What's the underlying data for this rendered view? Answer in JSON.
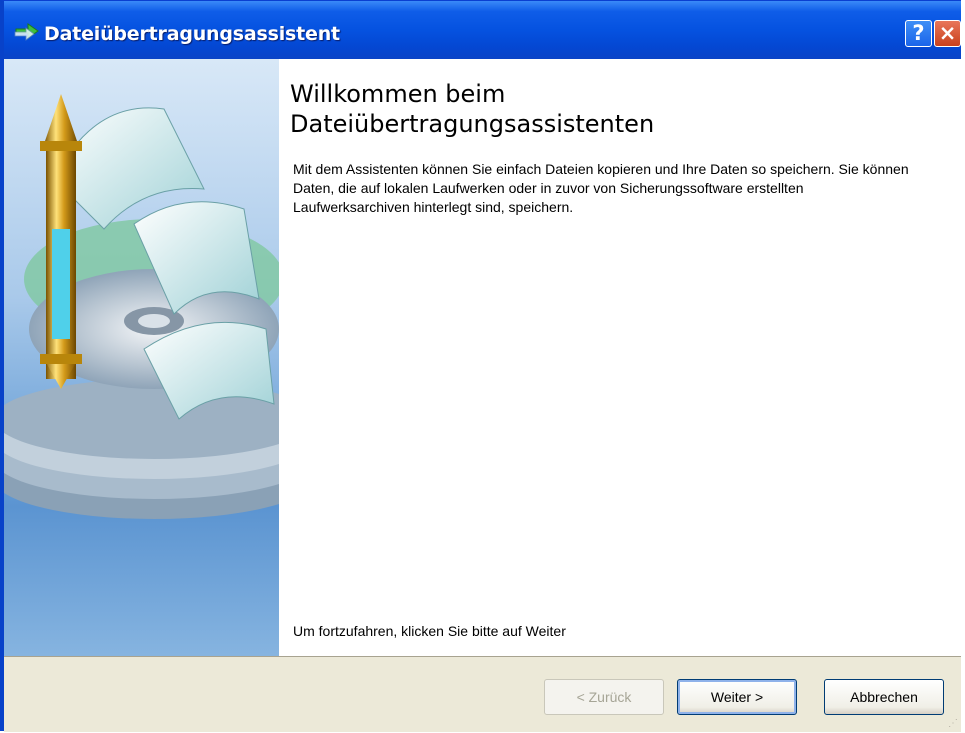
{
  "window": {
    "title": "Dateiübertragungsassistent",
    "help_label": "?",
    "close_label": "×"
  },
  "content": {
    "heading_line1": "Willkommen beim",
    "heading_line2": "Dateiübertragungsassistenten",
    "intro": "Mit dem Assistenten können Sie einfach Dateien kopieren und Ihre Daten so speichern. Sie können Daten, die auf lokalen Laufwerken oder in zuvor von Sicherungssoftware erstellten Laufwerksarchiven hinterlegt sind, speichern.",
    "continue_hint": "Um fortzufahren, klicken Sie bitte auf Weiter"
  },
  "buttons": {
    "back": "< Zurück",
    "next": "Weiter >",
    "cancel": "Abbrechen"
  },
  "colors": {
    "titlebar": "#0552e0",
    "footer": "#ece9d8",
    "close_button": "#c9411d"
  }
}
